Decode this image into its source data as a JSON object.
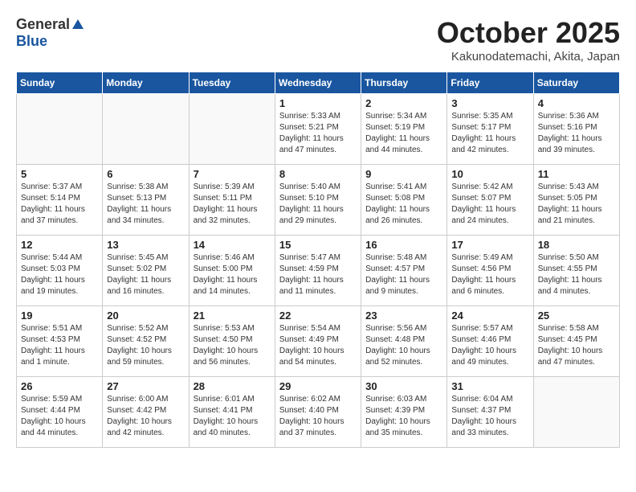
{
  "header": {
    "logo_general": "General",
    "logo_blue": "Blue",
    "month_title": "October 2025",
    "location": "Kakunodatemachi, Akita, Japan"
  },
  "weekdays": [
    "Sunday",
    "Monday",
    "Tuesday",
    "Wednesday",
    "Thursday",
    "Friday",
    "Saturday"
  ],
  "weeks": [
    [
      {
        "day": "",
        "info": ""
      },
      {
        "day": "",
        "info": ""
      },
      {
        "day": "",
        "info": ""
      },
      {
        "day": "1",
        "info": "Sunrise: 5:33 AM\nSunset: 5:21 PM\nDaylight: 11 hours\nand 47 minutes."
      },
      {
        "day": "2",
        "info": "Sunrise: 5:34 AM\nSunset: 5:19 PM\nDaylight: 11 hours\nand 44 minutes."
      },
      {
        "day": "3",
        "info": "Sunrise: 5:35 AM\nSunset: 5:17 PM\nDaylight: 11 hours\nand 42 minutes."
      },
      {
        "day": "4",
        "info": "Sunrise: 5:36 AM\nSunset: 5:16 PM\nDaylight: 11 hours\nand 39 minutes."
      }
    ],
    [
      {
        "day": "5",
        "info": "Sunrise: 5:37 AM\nSunset: 5:14 PM\nDaylight: 11 hours\nand 37 minutes."
      },
      {
        "day": "6",
        "info": "Sunrise: 5:38 AM\nSunset: 5:13 PM\nDaylight: 11 hours\nand 34 minutes."
      },
      {
        "day": "7",
        "info": "Sunrise: 5:39 AM\nSunset: 5:11 PM\nDaylight: 11 hours\nand 32 minutes."
      },
      {
        "day": "8",
        "info": "Sunrise: 5:40 AM\nSunset: 5:10 PM\nDaylight: 11 hours\nand 29 minutes."
      },
      {
        "day": "9",
        "info": "Sunrise: 5:41 AM\nSunset: 5:08 PM\nDaylight: 11 hours\nand 26 minutes."
      },
      {
        "day": "10",
        "info": "Sunrise: 5:42 AM\nSunset: 5:07 PM\nDaylight: 11 hours\nand 24 minutes."
      },
      {
        "day": "11",
        "info": "Sunrise: 5:43 AM\nSunset: 5:05 PM\nDaylight: 11 hours\nand 21 minutes."
      }
    ],
    [
      {
        "day": "12",
        "info": "Sunrise: 5:44 AM\nSunset: 5:03 PM\nDaylight: 11 hours\nand 19 minutes."
      },
      {
        "day": "13",
        "info": "Sunrise: 5:45 AM\nSunset: 5:02 PM\nDaylight: 11 hours\nand 16 minutes."
      },
      {
        "day": "14",
        "info": "Sunrise: 5:46 AM\nSunset: 5:00 PM\nDaylight: 11 hours\nand 14 minutes."
      },
      {
        "day": "15",
        "info": "Sunrise: 5:47 AM\nSunset: 4:59 PM\nDaylight: 11 hours\nand 11 minutes."
      },
      {
        "day": "16",
        "info": "Sunrise: 5:48 AM\nSunset: 4:57 PM\nDaylight: 11 hours\nand 9 minutes."
      },
      {
        "day": "17",
        "info": "Sunrise: 5:49 AM\nSunset: 4:56 PM\nDaylight: 11 hours\nand 6 minutes."
      },
      {
        "day": "18",
        "info": "Sunrise: 5:50 AM\nSunset: 4:55 PM\nDaylight: 11 hours\nand 4 minutes."
      }
    ],
    [
      {
        "day": "19",
        "info": "Sunrise: 5:51 AM\nSunset: 4:53 PM\nDaylight: 11 hours\nand 1 minute."
      },
      {
        "day": "20",
        "info": "Sunrise: 5:52 AM\nSunset: 4:52 PM\nDaylight: 10 hours\nand 59 minutes."
      },
      {
        "day": "21",
        "info": "Sunrise: 5:53 AM\nSunset: 4:50 PM\nDaylight: 10 hours\nand 56 minutes."
      },
      {
        "day": "22",
        "info": "Sunrise: 5:54 AM\nSunset: 4:49 PM\nDaylight: 10 hours\nand 54 minutes."
      },
      {
        "day": "23",
        "info": "Sunrise: 5:56 AM\nSunset: 4:48 PM\nDaylight: 10 hours\nand 52 minutes."
      },
      {
        "day": "24",
        "info": "Sunrise: 5:57 AM\nSunset: 4:46 PM\nDaylight: 10 hours\nand 49 minutes."
      },
      {
        "day": "25",
        "info": "Sunrise: 5:58 AM\nSunset: 4:45 PM\nDaylight: 10 hours\nand 47 minutes."
      }
    ],
    [
      {
        "day": "26",
        "info": "Sunrise: 5:59 AM\nSunset: 4:44 PM\nDaylight: 10 hours\nand 44 minutes."
      },
      {
        "day": "27",
        "info": "Sunrise: 6:00 AM\nSunset: 4:42 PM\nDaylight: 10 hours\nand 42 minutes."
      },
      {
        "day": "28",
        "info": "Sunrise: 6:01 AM\nSunset: 4:41 PM\nDaylight: 10 hours\nand 40 minutes."
      },
      {
        "day": "29",
        "info": "Sunrise: 6:02 AM\nSunset: 4:40 PM\nDaylight: 10 hours\nand 37 minutes."
      },
      {
        "day": "30",
        "info": "Sunrise: 6:03 AM\nSunset: 4:39 PM\nDaylight: 10 hours\nand 35 minutes."
      },
      {
        "day": "31",
        "info": "Sunrise: 6:04 AM\nSunset: 4:37 PM\nDaylight: 10 hours\nand 33 minutes."
      },
      {
        "day": "",
        "info": ""
      }
    ]
  ]
}
